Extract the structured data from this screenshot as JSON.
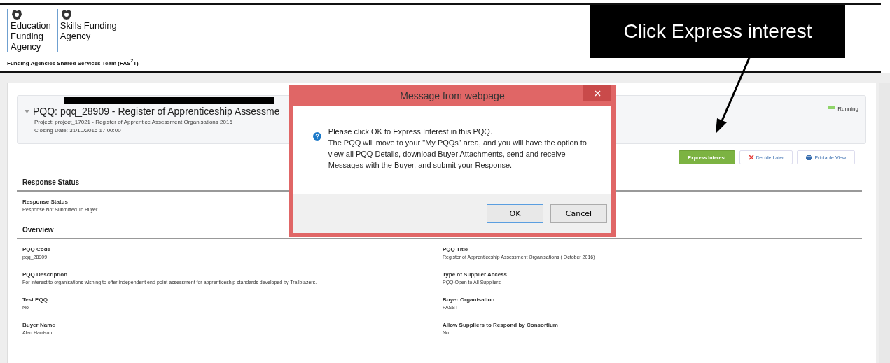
{
  "header": {
    "logos": [
      {
        "lines": [
          "Education",
          "Funding",
          "Agency"
        ]
      },
      {
        "lines": [
          "Skills Funding",
          "Agency"
        ]
      }
    ],
    "team": "Funding Agencies Shared Services Team (FAS$^{2}$T)"
  },
  "pqq": {
    "title": "PQQ: pqq_28909 - Register of Apprenticeship Assessme",
    "project": "Project: project_17021 - Register of Apprentice Assessment Organisations 2016",
    "closing": "Closing Date: 31/10/2016 17:00:00",
    "status": "Running"
  },
  "actions": [
    {
      "kind": "primary",
      "label": "Express Interest"
    },
    {
      "kind": "decline",
      "label": "Decide Later"
    },
    {
      "kind": "print",
      "label": "Printable View"
    }
  ],
  "sections": [
    {
      "title": "Response Status",
      "fields": [
        {
          "label": "Response Status",
          "value": "Response Not Submitted To Buyer"
        }
      ]
    },
    {
      "title": "Overview",
      "fields": [
        {
          "label": "PQQ Code",
          "value": "pqq_28909"
        },
        {
          "label": "PQQ Title",
          "value": "Register of Apprenticeship Assessment Organisations ( October 2016)"
        },
        {
          "label": "PQQ Description",
          "value": "For interest to organisations wishing to offer independent end-point assessment for apprenticeship standards developed by Trailblazers."
        },
        {
          "label": "Type of Supplier Access",
          "value": "PQQ Open to All Suppliers"
        },
        {
          "label": "Test PQQ",
          "value": "No"
        },
        {
          "label": "Buyer Organisation",
          "value": "FASST"
        },
        {
          "label": "Buyer Name",
          "value": "Alan Harrison"
        },
        {
          "label": "Allow Suppliers to Respond by Consortium",
          "value": "No"
        }
      ]
    }
  ],
  "dialog": {
    "title": "Message from webpage",
    "paragraphs": [
      "Please click OK to Express Interest in this PQQ.",
      "The PQQ will move to your \"My PQQs\" area, and you will have the option to view all PQQ Details, download Buyer Attachments, send and receive Messages with the Buyer, and submit your Response."
    ],
    "buttons": [
      {
        "label": "OK",
        "selected": true
      },
      {
        "label": "Cancel",
        "selected": false
      }
    ]
  },
  "callout": {
    "text": "Click Express interest"
  }
}
